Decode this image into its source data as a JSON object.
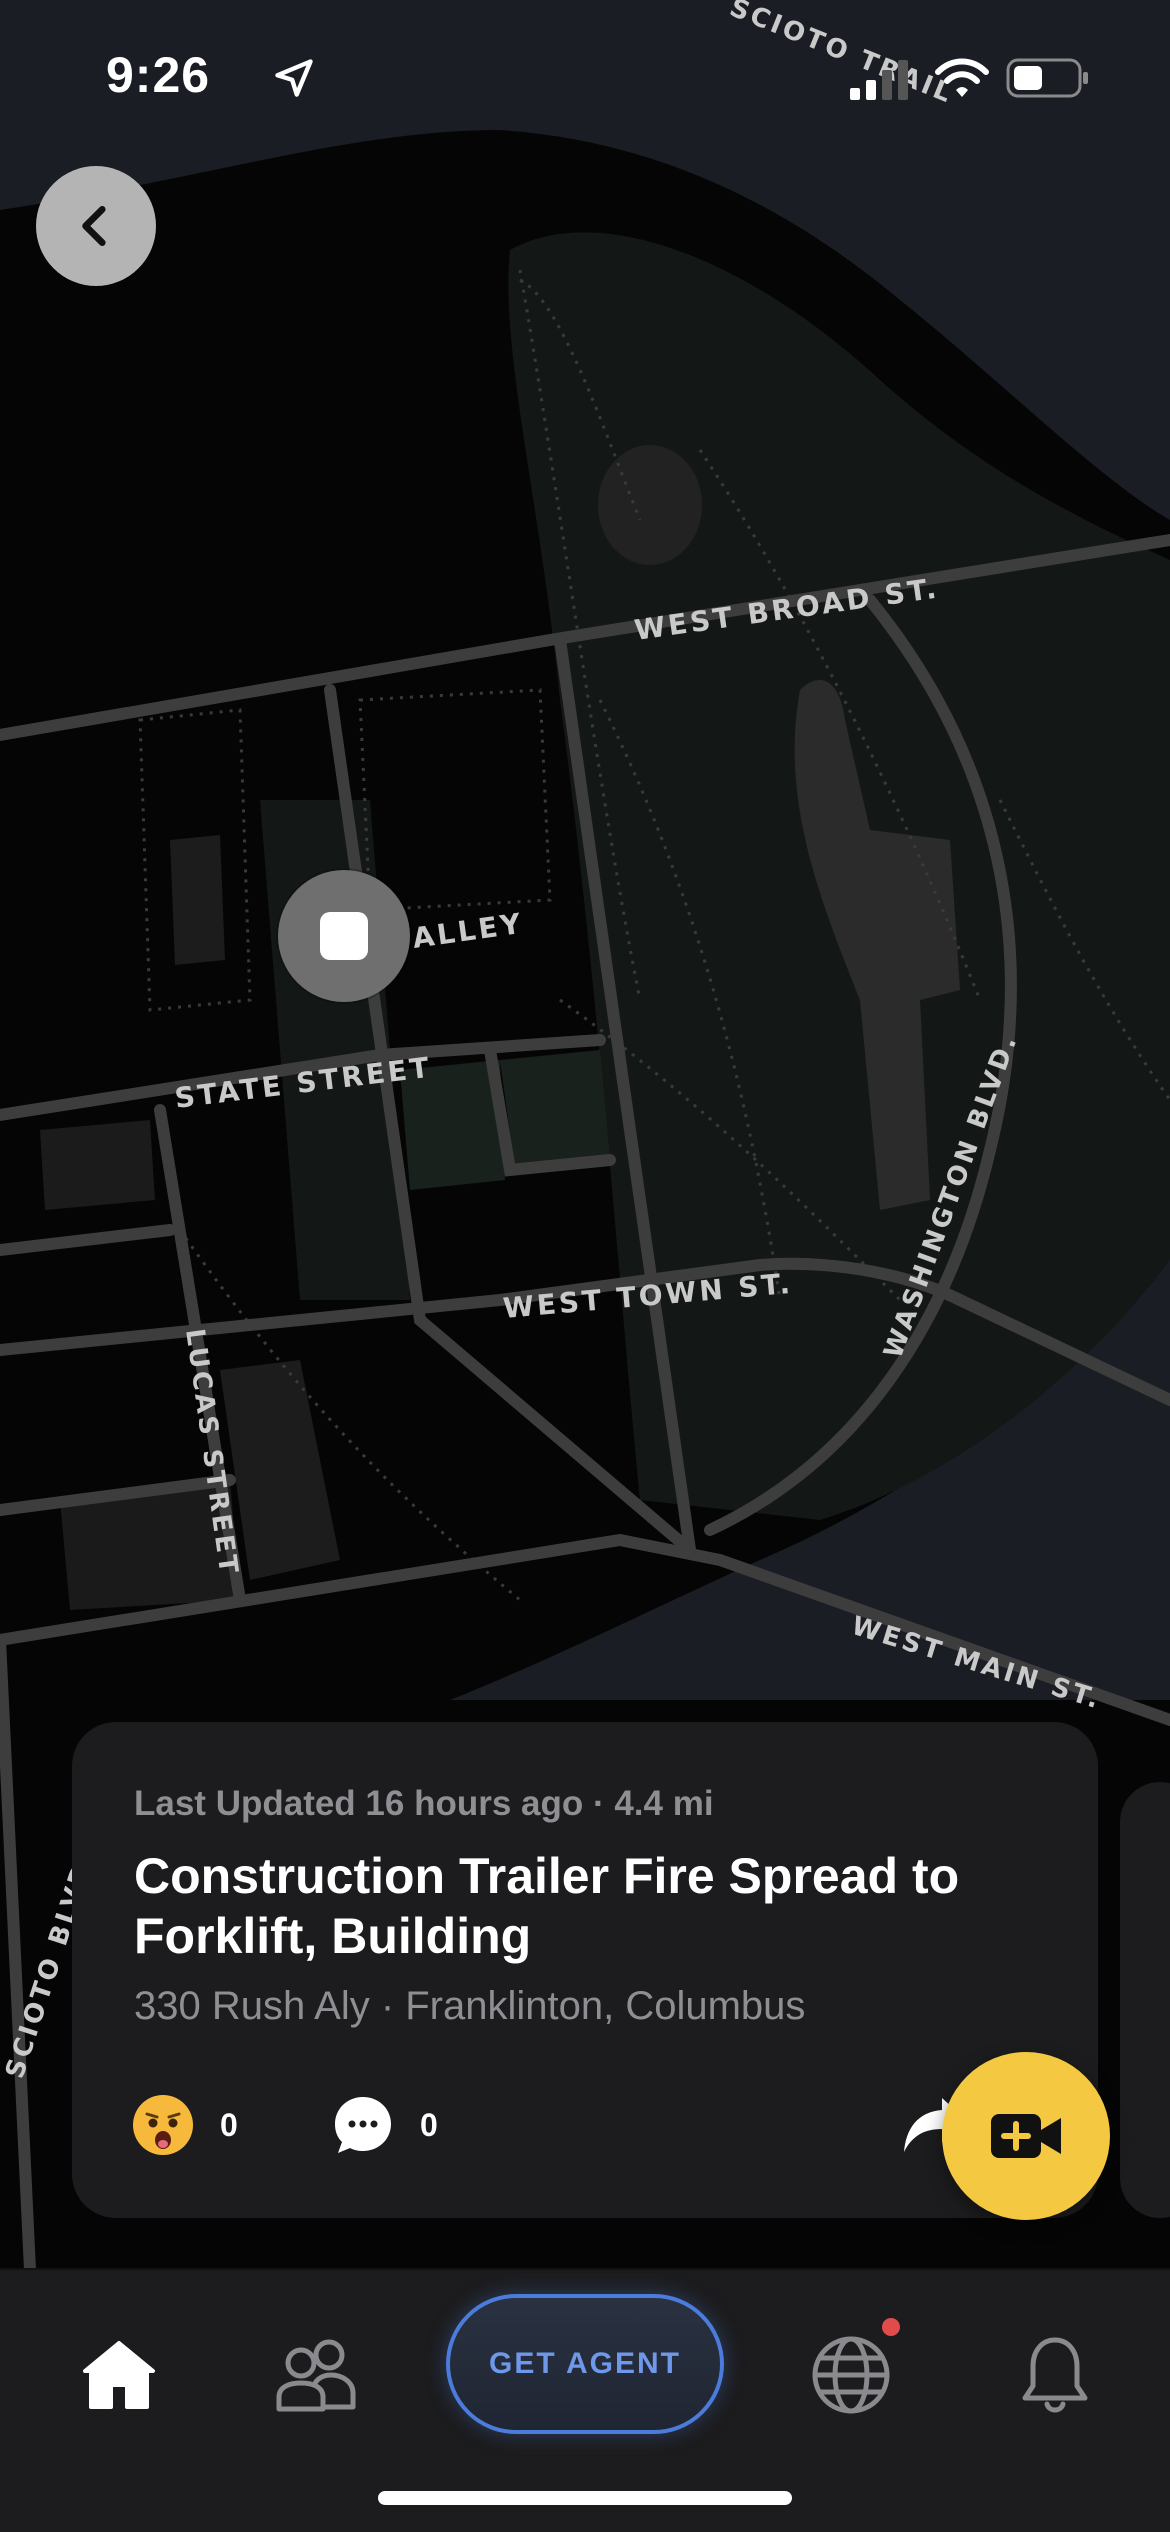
{
  "status_bar": {
    "time": "9:26"
  },
  "map": {
    "streets": {
      "west_broad": "WEST BROAD ST.",
      "alley": "ALLEY",
      "state": "STATE STREET",
      "west_town": "WEST TOWN ST.",
      "washington": "WASHINGTON BLVD.",
      "lucas": "LUCAS STREET",
      "west_main": "WEST MAIN ST.",
      "scioto_trail": "SCIOTO TRAIL",
      "scioto_blvd": "SCIOTO BLVD."
    }
  },
  "incident": {
    "meta": "Last Updated 16 hours ago · 4.4 mi",
    "title": "Construction Trailer Fire Spread to Forklift, Building",
    "address": "330 Rush Aly · Franklinton, Columbus",
    "reactions": "0",
    "comments": "0",
    "share_label": "S"
  },
  "tabbar": {
    "agent_label": "GET AGENT"
  },
  "icons": {
    "back": "chevron-left-icon",
    "fab": "video-plus-icon",
    "home": "home-icon",
    "people": "people-icon",
    "globe": "globe-icon",
    "bell": "bell-icon"
  },
  "colors": {
    "accent": "#f5c842",
    "agent": "#4b7bdb",
    "notification": "#e24b4b"
  }
}
